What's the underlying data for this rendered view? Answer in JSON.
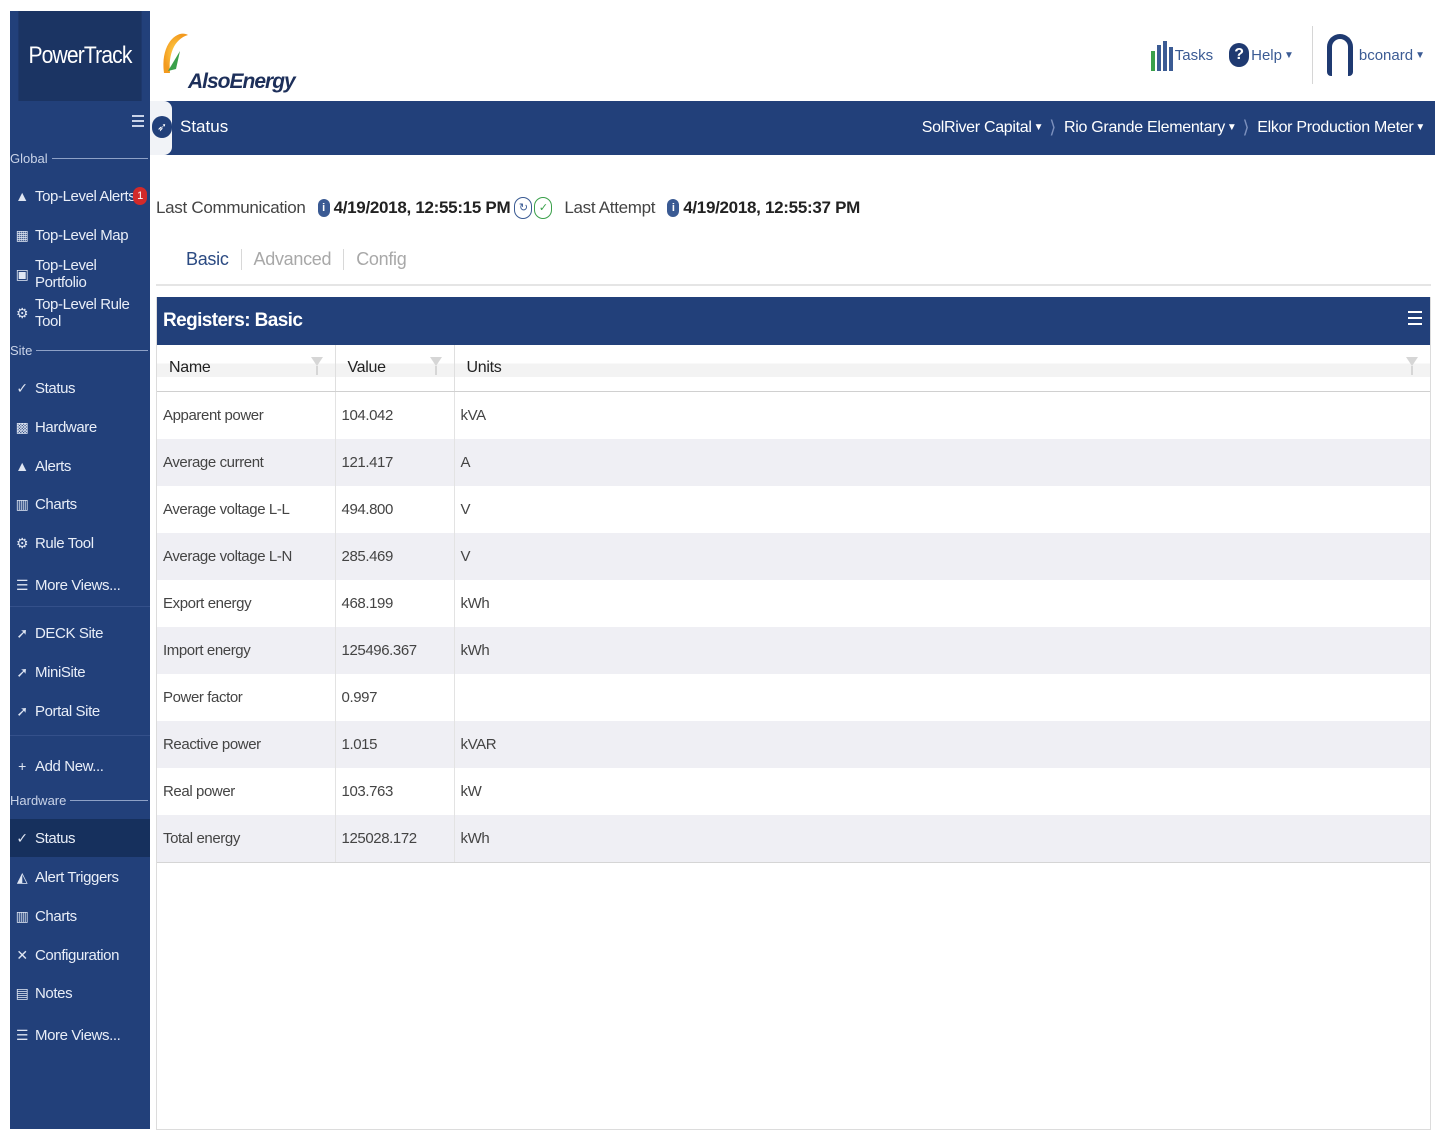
{
  "sidebar": {
    "brand": "PowerTrack",
    "global_label": "Global",
    "site_label": "Site",
    "hardware_label": "Hardware",
    "global_items": [
      {
        "label": "Top-Level Alerts",
        "icon": "alert-triangle-icon",
        "badge": "1"
      },
      {
        "label": "Top-Level Map",
        "icon": "map-icon"
      },
      {
        "label": "Top-Level Portfolio",
        "icon": "briefcase-icon"
      },
      {
        "label": "Top-Level Rule Tool",
        "icon": "rules-icon"
      }
    ],
    "site_items": [
      {
        "label": "Status",
        "icon": "check-circle-icon"
      },
      {
        "label": "Hardware",
        "icon": "chip-icon"
      },
      {
        "label": "Alerts",
        "icon": "alert-triangle-icon"
      },
      {
        "label": "Charts",
        "icon": "bar-chart-icon"
      },
      {
        "label": "Rule Tool",
        "icon": "rules-icon"
      },
      {
        "label": "More Views...",
        "icon": "menu-icon"
      }
    ],
    "link_items": [
      {
        "label": "DECK Site",
        "icon": "cursor-click-icon"
      },
      {
        "label": "MiniSite",
        "icon": "cursor-click-icon"
      },
      {
        "label": "Portal Site",
        "icon": "cursor-click-icon"
      }
    ],
    "add_new": "Add New...",
    "hardware_items": [
      {
        "label": "Status",
        "icon": "check-circle-icon",
        "active": true
      },
      {
        "label": "Alert Triggers",
        "icon": "trigger-icon"
      },
      {
        "label": "Charts",
        "icon": "bar-chart-icon"
      },
      {
        "label": "Configuration",
        "icon": "tools-icon"
      },
      {
        "label": "Notes",
        "icon": "notes-icon"
      },
      {
        "label": "More Views...",
        "icon": "menu-icon"
      }
    ]
  },
  "header": {
    "logo_text": "AlsoEnergy",
    "tasks": "Tasks",
    "help": "Help",
    "user": "bconard"
  },
  "statusbar": {
    "title": "Status",
    "breadcrumbs": [
      "SolRiver Capital",
      "Rio Grande Elementary",
      "Elkor Production Meter"
    ]
  },
  "comm": {
    "last_comm_label": "Last Communication",
    "last_comm_value": "4/19/2018, 12:55:15 PM",
    "last_attempt_label": "Last Attempt",
    "last_attempt_value": "4/19/2018, 12:55:37 PM"
  },
  "tabs": [
    "Basic",
    "Advanced",
    "Config"
  ],
  "panel": {
    "title": "Registers: Basic",
    "columns": [
      "Name",
      "Value",
      "Units"
    ],
    "rows": [
      {
        "name": "Apparent power",
        "value": "104.042",
        "units": "kVA"
      },
      {
        "name": "Average current",
        "value": "121.417",
        "units": "A"
      },
      {
        "name": "Average voltage L-L",
        "value": "494.800",
        "units": "V"
      },
      {
        "name": "Average voltage L-N",
        "value": "285.469",
        "units": "V"
      },
      {
        "name": "Export energy",
        "value": "468.199",
        "units": "kWh"
      },
      {
        "name": "Import energy",
        "value": "125496.367",
        "units": "kWh"
      },
      {
        "name": "Power factor",
        "value": "0.997",
        "units": ""
      },
      {
        "name": "Reactive power",
        "value": "1.015",
        "units": "kVAR"
      },
      {
        "name": "Real power",
        "value": "103.763",
        "units": "kW"
      },
      {
        "name": "Total energy",
        "value": "125028.172",
        "units": "kWh"
      }
    ]
  },
  "colors": {
    "navy": "#22407a",
    "navy_dark": "#1b3463",
    "alert_red": "#d22a2a",
    "ok_green": "#3aa04a"
  }
}
